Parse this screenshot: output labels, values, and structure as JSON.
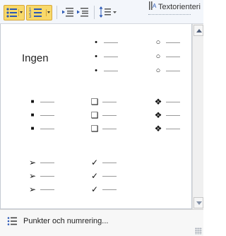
{
  "ribbon": {
    "text_direction_label": "Textorienteri",
    "buttons": [
      {
        "name": "bullets-button",
        "icon": "bullet-list-icon",
        "state": "active"
      },
      {
        "name": "numbering-button",
        "icon": "numbered-list-icon",
        "state": "active"
      },
      {
        "name": "decrease-indent-button",
        "icon": "decrease-indent-icon"
      },
      {
        "name": "increase-indent-button",
        "icon": "increase-indent-icon"
      },
      {
        "name": "line-spacing-button",
        "icon": "line-spacing-icon"
      }
    ]
  },
  "gallery": {
    "none_label": "Ingen",
    "rows": [
      [
        {
          "name": "bullet-style-none",
          "label": "Ingen"
        },
        {
          "name": "bullet-style-small-dot",
          "icon": "small-dot-bullet-icon",
          "glyph": "•"
        },
        {
          "name": "bullet-style-hollow-circle",
          "icon": "hollow-circle-bullet-icon",
          "glyph": "○"
        }
      ],
      [
        {
          "name": "bullet-style-filled-square",
          "icon": "filled-square-bullet-icon",
          "glyph": "■"
        },
        {
          "name": "bullet-style-hollow-square",
          "icon": "hollow-square-bullet-icon",
          "glyph": "❑"
        },
        {
          "name": "bullet-style-diamond-star",
          "icon": "four-diamond-bullet-icon",
          "glyph": "❖"
        }
      ],
      [
        {
          "name": "bullet-style-arrowhead",
          "icon": "arrowhead-bullet-icon",
          "glyph": "➢"
        },
        {
          "name": "bullet-style-checkmark",
          "icon": "checkmark-bullet-icon",
          "glyph": "✓"
        }
      ]
    ]
  },
  "footer": {
    "label": "Punkter och numrering...",
    "icon": "bullet-list-icon"
  },
  "colors": {
    "active_button": "#f8d96a",
    "active_border": "#d7a73a",
    "ribbon_bg": "#f3f6fb",
    "footer_bg": "#f7f7f7"
  }
}
